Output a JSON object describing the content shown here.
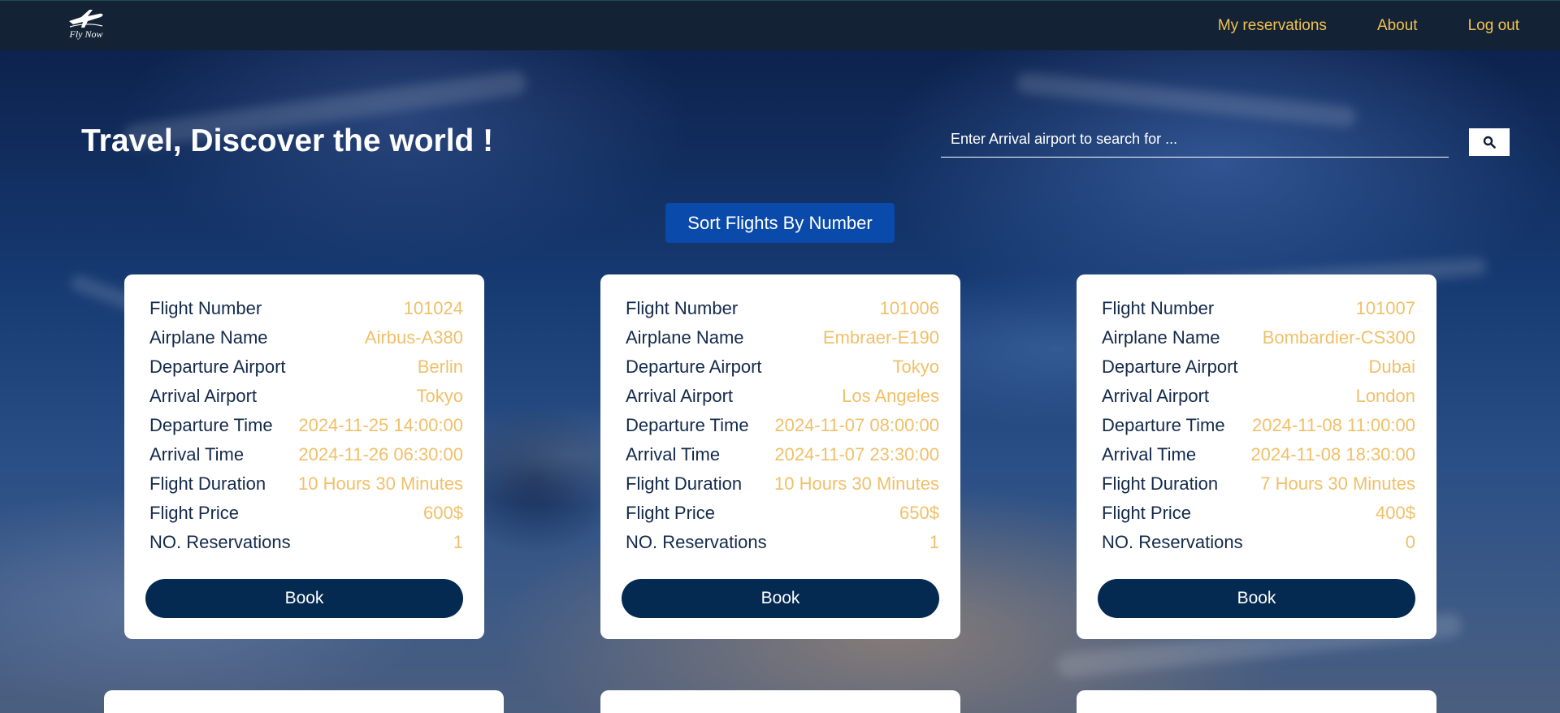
{
  "nav": {
    "logo_text": "Fly Now",
    "links": [
      "My reservations",
      "About",
      "Log out"
    ]
  },
  "hero": {
    "title": "Travel, Discover the world !",
    "search_placeholder": "Enter Arrival airport to search for ..."
  },
  "sort_button": "Sort Flights By Number",
  "labels": {
    "flight_number": "Flight Number",
    "airplane_name": "Airplane Name",
    "departure_airport": "Departure Airport",
    "arrival_airport": "Arrival Airport",
    "departure_time": "Departure Time",
    "arrival_time": "Arrival Time",
    "flight_duration": "Flight Duration",
    "flight_price": "Flight Price",
    "reservations": "NO. Reservations",
    "book": "Book"
  },
  "flights": [
    {
      "flight_number": "101024",
      "airplane_name": "Airbus-A380",
      "departure_airport": "Berlin",
      "arrival_airport": "Tokyo",
      "departure_time": "2024-11-25 14:00:00",
      "arrival_time": "2024-11-26 06:30:00",
      "flight_duration": "10 Hours 30 Minutes",
      "flight_price": "600$",
      "reservations": "1"
    },
    {
      "flight_number": "101006",
      "airplane_name": "Embraer-E190",
      "departure_airport": "Tokyo",
      "arrival_airport": "Los Angeles",
      "departure_time": "2024-11-07 08:00:00",
      "arrival_time": "2024-11-07 23:30:00",
      "flight_duration": "10 Hours 30 Minutes",
      "flight_price": "650$",
      "reservations": "1"
    },
    {
      "flight_number": "101007",
      "airplane_name": "Bombardier-CS300",
      "departure_airport": "Dubai",
      "arrival_airport": "London",
      "departure_time": "2024-11-08 11:00:00",
      "arrival_time": "2024-11-08 18:30:00",
      "flight_duration": "7 Hours 30 Minutes",
      "flight_price": "400$",
      "reservations": "0"
    }
  ],
  "colors": {
    "navbar": "#132235",
    "nav_link": "#f2c14e",
    "value_text": "#f0c069",
    "label_text": "#132a4a",
    "book_button": "#042a51",
    "sort_button": "#0a4aaa"
  },
  "icons": {
    "logo": "airplane-logo-icon",
    "search": "search-icon"
  }
}
